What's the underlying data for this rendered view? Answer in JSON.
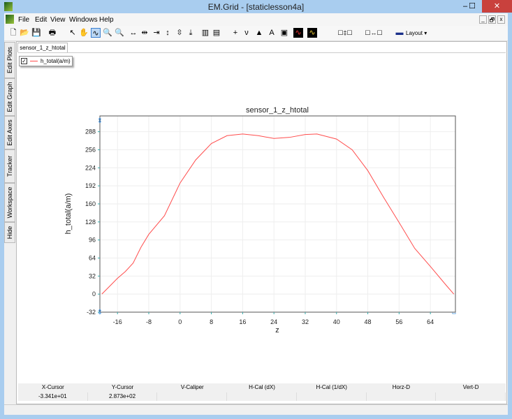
{
  "window": {
    "title": "EM.Grid - [staticlesson4a]",
    "minimize": "–",
    "maximize": "☐",
    "close": "✕"
  },
  "menu": [
    "File",
    "Edit",
    "View",
    "Windows",
    "Help"
  ],
  "mdi_controls": [
    "_",
    "🗗",
    "x"
  ],
  "toolbar": [
    {
      "icon": "new-file-icon",
      "glyph": "🗋"
    },
    {
      "icon": "open-folder-icon",
      "glyph": "📂"
    },
    {
      "icon": "save-icon",
      "glyph": "💾"
    },
    {
      "icon": "print-icon",
      "glyph": "🖶"
    },
    {
      "icon": "pointer-icon",
      "glyph": "↖"
    },
    {
      "icon": "pan-hand-icon",
      "glyph": "✋"
    },
    {
      "icon": "autoscale-icon",
      "glyph": "∿"
    },
    {
      "icon": "zoom-in-icon",
      "glyph": "🔍"
    },
    {
      "icon": "zoom-out-icon",
      "glyph": "🔍"
    },
    {
      "icon": "expand-horizontal-icon",
      "glyph": "↔"
    },
    {
      "icon": "compress-horizontal-icon",
      "glyph": "⇹"
    },
    {
      "icon": "fit-horizontal-icon",
      "glyph": "⇥"
    },
    {
      "icon": "expand-vertical-icon",
      "glyph": "↕"
    },
    {
      "icon": "compress-vertical-icon",
      "glyph": "⇳"
    },
    {
      "icon": "fit-vertical-icon",
      "glyph": "⤓"
    },
    {
      "icon": "vertical-bars-icon",
      "glyph": "▥"
    },
    {
      "icon": "horizontal-bars-icon",
      "glyph": "▤"
    },
    {
      "icon": "crosshair-icon",
      "glyph": "+"
    },
    {
      "icon": "tracker-icon",
      "glyph": "ν"
    },
    {
      "icon": "marker-icon",
      "glyph": "▲"
    },
    {
      "icon": "text-icon",
      "glyph": "A"
    },
    {
      "icon": "inset-icon",
      "glyph": "▣"
    },
    {
      "icon": "red-waveform-icon",
      "glyph": "∿"
    },
    {
      "icon": "yellow-waveform-icon",
      "glyph": "∿"
    },
    {
      "icon": "vertical-caliper-icon",
      "glyph": "☐‡☐"
    },
    {
      "icon": "horizontal-caliper-icon",
      "glyph": "☐↔☐"
    },
    {
      "icon": "layout-icon",
      "glyph": "▬",
      "label": "Layout ▾"
    }
  ],
  "side_tabs": [
    "Edit Plots",
    "Edit Graph",
    "Edit Axes",
    "Tracker",
    "Workspace",
    "Hide"
  ],
  "doc_tab": "sensor_1_z_htotal",
  "legend": {
    "checked": true,
    "label": "h_total(a/m)"
  },
  "chart_data": {
    "type": "line",
    "title": "sensor_1_z_htotal",
    "xlabel": "z",
    "ylabel": "h_total(a/m)",
    "xlim": [
      -20.5,
      70.4
    ],
    "ylim": [
      -32,
      316
    ],
    "xticks": [
      -16,
      -8,
      0,
      8,
      16,
      24,
      32,
      40,
      48,
      56,
      64
    ],
    "yticks": [
      -32,
      0,
      32,
      64,
      96,
      128,
      160,
      192,
      224,
      256,
      288
    ],
    "grid": true,
    "series": [
      {
        "name": "h_total(a/m)",
        "color": "#ff4d4d",
        "x": [
          -20,
          -18,
          -16,
          -14,
          -12,
          -10,
          -8,
          -4,
          0,
          4,
          8,
          12,
          16,
          20,
          24,
          28,
          32,
          35,
          40,
          44,
          48,
          52,
          56,
          60,
          64,
          68,
          70
        ],
        "y": [
          0,
          14,
          28,
          40,
          55,
          83,
          106,
          139,
          197,
          238,
          267,
          281,
          284,
          281,
          276,
          278,
          283,
          284,
          275,
          256,
          219,
          172,
          127,
          81,
          49,
          16,
          0
        ]
      }
    ]
  },
  "cursor_table": {
    "headers": [
      "X-Cursor",
      "Y-Cursor",
      "V-Caliper",
      "H-Cal (dX)",
      "H-Cal (1/dX)",
      "Horz-D",
      "Vert-D"
    ],
    "values": [
      "-3.341e+01",
      "2.873e+02",
      "",
      "",
      "",
      "",
      ""
    ]
  }
}
